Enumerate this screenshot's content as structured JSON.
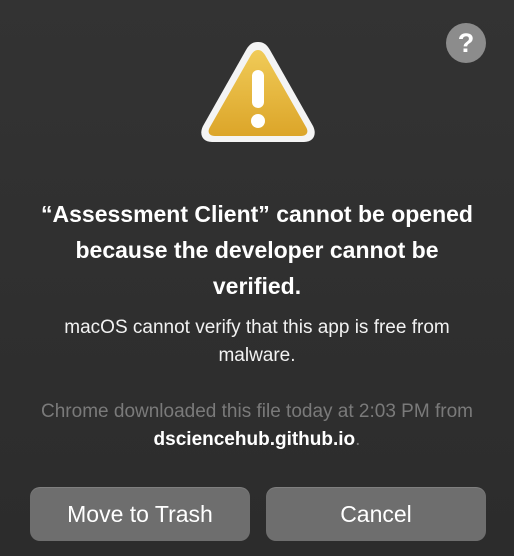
{
  "dialog": {
    "help_label": "?",
    "icon": "warning-icon",
    "title": "“Assessment Client” cannot be opened because the developer cannot be verified.",
    "message": "macOS cannot verify that this app is free from malware.",
    "info_prefix": "Chrome downloaded this file today at 2:03 PM from ",
    "info_domain": "dsciencehub.github.io",
    "info_suffix": "."
  },
  "buttons": {
    "move_to_trash": "Move to Trash",
    "cancel": "Cancel"
  },
  "colors": {
    "background": "#2e2e2e",
    "button": "#6e6e6e",
    "help_button": "#8c8c8c",
    "warning_fill": "#e6b63c",
    "dim_text": "#7a7a7a"
  }
}
